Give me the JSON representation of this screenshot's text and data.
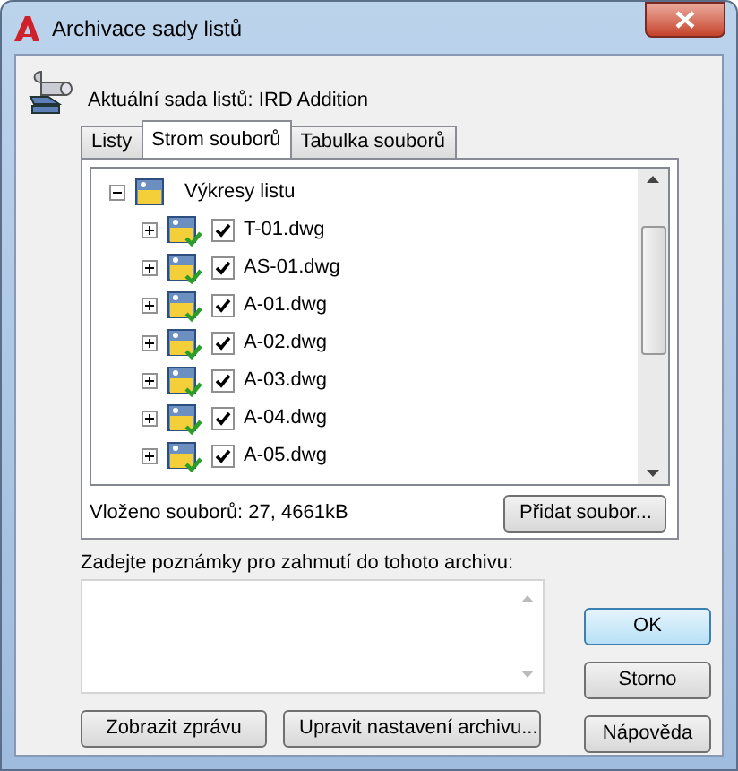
{
  "window": {
    "title": "Archivace sady listů"
  },
  "current_set": "Aktuální sada listů: IRD Addition",
  "tabs": [
    {
      "label": "Listy",
      "selected": false
    },
    {
      "label": "Strom souborů",
      "selected": true
    },
    {
      "label": "Tabulka souborů",
      "selected": false
    }
  ],
  "tree": {
    "label": "Výkresy listu",
    "expanded": true,
    "children": [
      {
        "label": "T-01.dwg",
        "checked": true,
        "expanded": false
      },
      {
        "label": "AS-01.dwg",
        "checked": true,
        "expanded": false
      },
      {
        "label": "A-01.dwg",
        "checked": true,
        "expanded": false
      },
      {
        "label": "A-02.dwg",
        "checked": true,
        "expanded": false
      },
      {
        "label": "A-03.dwg",
        "checked": true,
        "expanded": false
      },
      {
        "label": "A-04.dwg",
        "checked": true,
        "expanded": false
      },
      {
        "label": "A-05.dwg",
        "checked": true,
        "expanded": false
      }
    ]
  },
  "summary": "Vloženo souborů: 27, 4661kB",
  "add_file_button": "Přidat soubor...",
  "notes": {
    "label": "Zadejte poznámky pro zahmutí do tohoto archivu:"
  },
  "buttons": {
    "ok": "OK",
    "cancel": "Storno",
    "help": "Nápověda",
    "view_report": "Zobrazit zprávu",
    "modify_settings": "Upravit nastavení archivu..."
  }
}
